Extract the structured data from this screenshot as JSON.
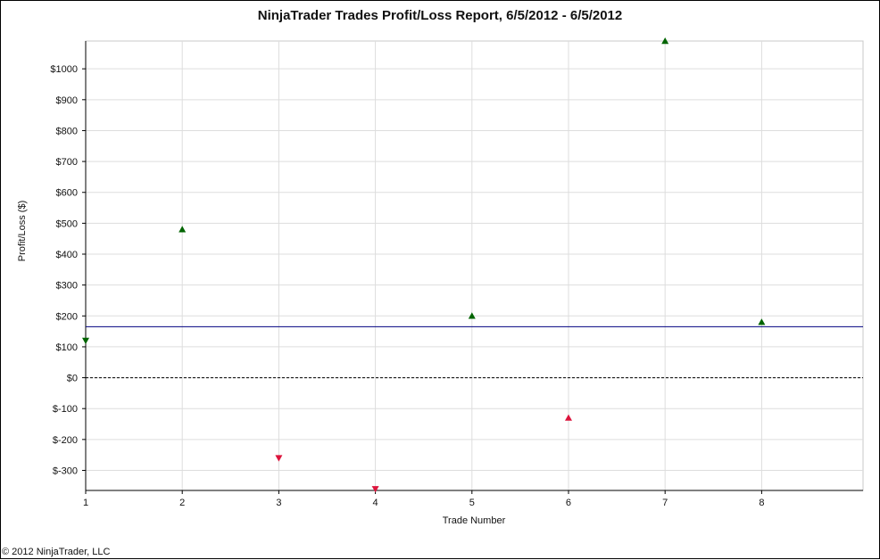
{
  "chart_data": {
    "type": "scatter",
    "title": "NinjaTrader Trades Profit/Loss Report, 6/5/2012 - 6/5/2012",
    "xlabel": "Trade Number",
    "ylabel": "Profit/Loss ($)",
    "xlim": [
      1,
      9.05
    ],
    "ylim": [
      -365,
      1090
    ],
    "x_ticks": [
      1,
      2,
      3,
      4,
      5,
      6,
      7,
      8
    ],
    "y_ticks": [
      -300,
      -200,
      -100,
      0,
      100,
      200,
      300,
      400,
      500,
      600,
      700,
      800,
      900,
      1000
    ],
    "y_tick_labels": [
      "$-300",
      "$-200",
      "$-100",
      "$0",
      "$100",
      "$200",
      "$300",
      "$400",
      "$500",
      "$600",
      "$700",
      "$800",
      "$900",
      "$1000"
    ],
    "grid": true,
    "zero_line": 0,
    "average_line": 165,
    "points": [
      {
        "x": 1,
        "y": 120,
        "marker": "triangle-down",
        "color": "#006400"
      },
      {
        "x": 2,
        "y": 480,
        "marker": "triangle-up",
        "color": "#006400"
      },
      {
        "x": 3,
        "y": -260,
        "marker": "triangle-down",
        "color": "#dc143c"
      },
      {
        "x": 4,
        "y": -360,
        "marker": "triangle-down",
        "color": "#dc143c"
      },
      {
        "x": 5,
        "y": 200,
        "marker": "triangle-up",
        "color": "#006400"
      },
      {
        "x": 6,
        "y": -130,
        "marker": "triangle-up",
        "color": "#dc143c"
      },
      {
        "x": 7,
        "y": 1090,
        "marker": "triangle-up",
        "color": "#006400"
      },
      {
        "x": 8,
        "y": 180,
        "marker": "triangle-up",
        "color": "#006400"
      }
    ],
    "colors": {
      "grid": "#dddddd",
      "average_line": "#000080",
      "zero_line": "#000000"
    }
  },
  "footer": {
    "copyright": "© 2012 NinjaTrader, LLC"
  }
}
